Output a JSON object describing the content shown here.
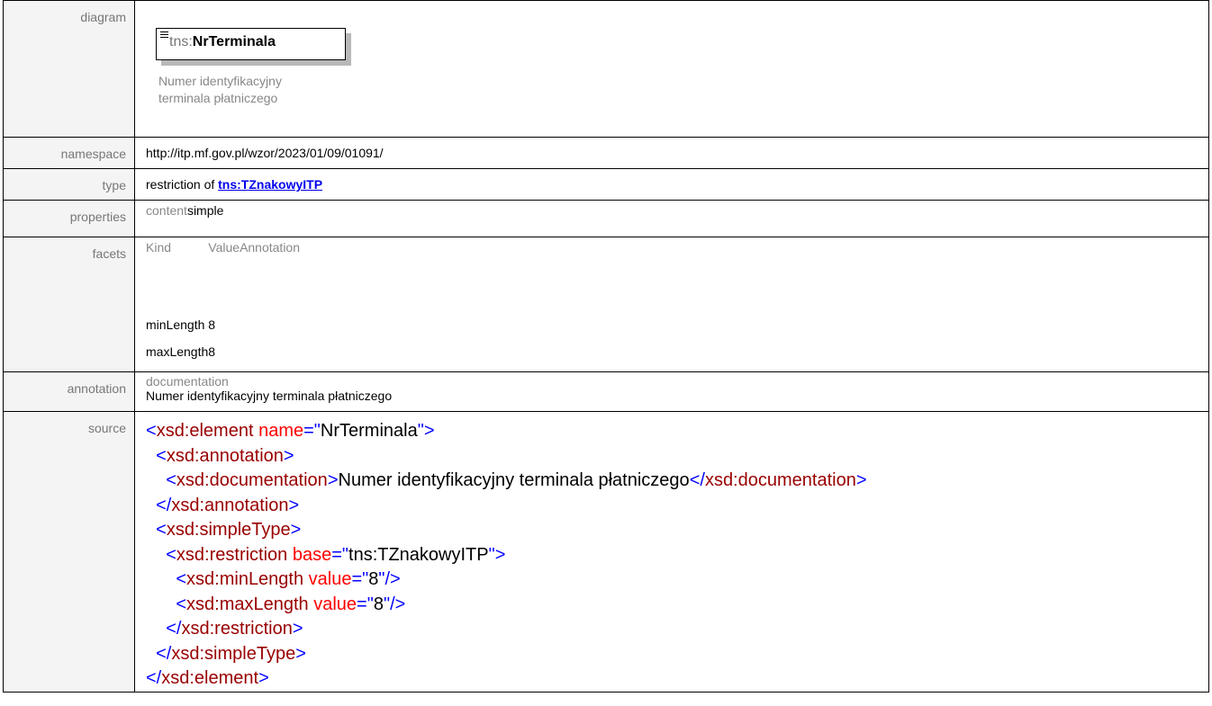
{
  "labels": {
    "diagram": "diagram",
    "namespace": "namespace",
    "type": "type",
    "properties": "properties",
    "facets": "facets",
    "annotation": "annotation",
    "source": "source"
  },
  "diagram": {
    "prefix": "tns:",
    "name": "NrTerminala",
    "doc_line1": "Numer identyfikacyjny",
    "doc_line2": "terminala płatniczego"
  },
  "namespace": "http://itp.mf.gov.pl/wzor/2023/01/09/01091/",
  "type": {
    "prefix": "restriction of ",
    "link": "tns:TZnakowyITP"
  },
  "properties": {
    "key": "content",
    "value": "simple"
  },
  "facets": {
    "headers": [
      "Kind",
      "Value",
      "Annotation"
    ],
    "rows": [
      {
        "kind": "minLength",
        "value": "8"
      },
      {
        "kind": "maxLength",
        "value": "8"
      }
    ]
  },
  "annotation": {
    "heading": "documentation",
    "text": "Numer identyfikacyjny terminala płatniczego"
  },
  "source": {
    "lines": [
      "<xsd:element name=\"NrTerminala\">",
      "  <xsd:annotation>",
      "    <xsd:documentation>Numer identyfikacyjny terminala płatniczego</xsd:documentation>",
      "  </xsd:annotation>",
      "  <xsd:simpleType>",
      "    <xsd:restriction base=\"tns:TZnakowyITP\">",
      "      <xsd:minLength value=\"8\"/>",
      "      <xsd:maxLength value=\"8\"/>",
      "    </xsd:restriction>",
      "  </xsd:simpleType>",
      "</xsd:element>"
    ]
  },
  "colors": {
    "tag": "#990000",
    "punct": "#0000ff",
    "attr": "#ff0000",
    "link": "#0000ee",
    "label_bg": "#f4f4f4"
  }
}
